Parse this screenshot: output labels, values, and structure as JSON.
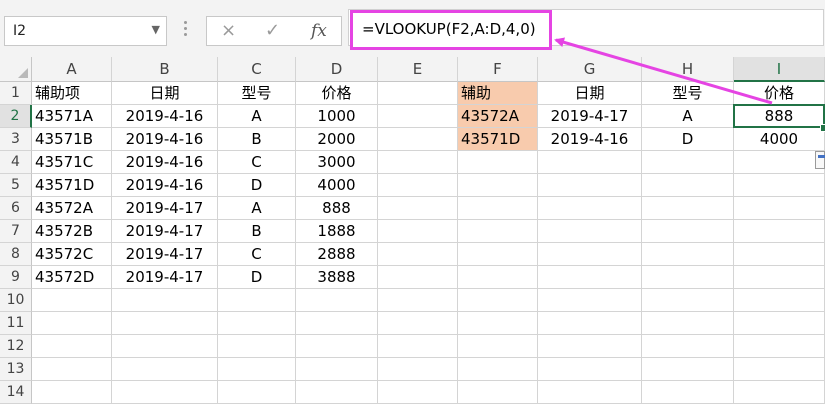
{
  "name_box": {
    "value": "I2"
  },
  "formula_bar": {
    "cancel_icon": "×",
    "enter_icon": "✓",
    "fx_label": "fx",
    "formula": "=VLOOKUP(F2,A:D,4,0)"
  },
  "columns": [
    "A",
    "B",
    "C",
    "D",
    "E",
    "F",
    "G",
    "H",
    "I"
  ],
  "selected_column": "I",
  "rows": [
    "1",
    "2",
    "3",
    "4",
    "5",
    "6",
    "7",
    "8",
    "9",
    "10",
    "11",
    "12",
    "13",
    "14"
  ],
  "selected_row": "2",
  "cells": {
    "A1": "辅助项",
    "B1": "日期",
    "C1": "型号",
    "D1": "价格",
    "A2": "43571A",
    "B2": "2019-4-16",
    "C2": "A",
    "D2": "1000",
    "A3": "43571B",
    "B3": "2019-4-16",
    "C3": "B",
    "D3": "2000",
    "A4": "43571C",
    "B4": "2019-4-16",
    "C4": "C",
    "D4": "3000",
    "A5": "43571D",
    "B5": "2019-4-16",
    "C5": "D",
    "D5": "4000",
    "A6": "43572A",
    "B6": "2019-4-17",
    "C6": "A",
    "D6": "888",
    "A7": "43572B",
    "B7": "2019-4-17",
    "C7": "B",
    "D7": "1888",
    "A8": "43572C",
    "B8": "2019-4-17",
    "C8": "C",
    "D8": "2888",
    "A9": "43572D",
    "B9": "2019-4-17",
    "C9": "D",
    "D9": "3888",
    "F1": "辅助",
    "G1": "日期",
    "H1": "型号",
    "I1": "价格",
    "F2": "43572A",
    "G2": "2019-4-17",
    "H2": "A",
    "I2": "888",
    "F3": "43571D",
    "G3": "2019-4-16",
    "H3": "D",
    "I3": "4000"
  },
  "colors": {
    "accent": "#217346",
    "highlight": "#e544e3",
    "peach_fill": "#f8cbad"
  }
}
